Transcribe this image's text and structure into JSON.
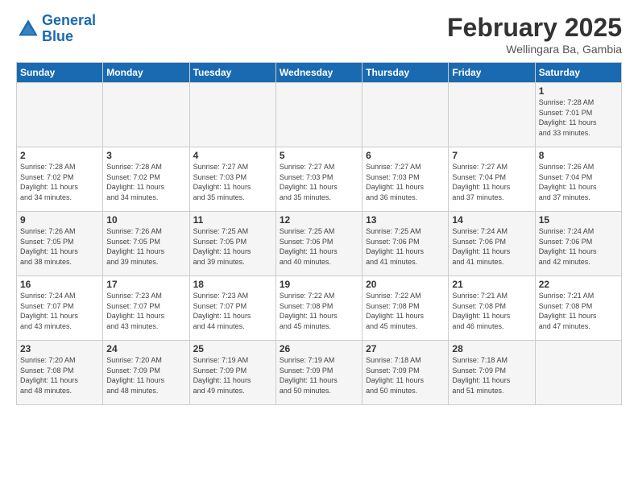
{
  "logo": {
    "line1": "General",
    "line2": "Blue"
  },
  "title": "February 2025",
  "location": "Wellingara Ba, Gambia",
  "weekdays": [
    "Sunday",
    "Monday",
    "Tuesday",
    "Wednesday",
    "Thursday",
    "Friday",
    "Saturday"
  ],
  "weeks": [
    [
      {
        "day": "",
        "info": ""
      },
      {
        "day": "",
        "info": ""
      },
      {
        "day": "",
        "info": ""
      },
      {
        "day": "",
        "info": ""
      },
      {
        "day": "",
        "info": ""
      },
      {
        "day": "",
        "info": ""
      },
      {
        "day": "1",
        "info": "Sunrise: 7:28 AM\nSunset: 7:01 PM\nDaylight: 11 hours\nand 33 minutes."
      }
    ],
    [
      {
        "day": "2",
        "info": "Sunrise: 7:28 AM\nSunset: 7:02 PM\nDaylight: 11 hours\nand 34 minutes."
      },
      {
        "day": "3",
        "info": "Sunrise: 7:28 AM\nSunset: 7:02 PM\nDaylight: 11 hours\nand 34 minutes."
      },
      {
        "day": "4",
        "info": "Sunrise: 7:27 AM\nSunset: 7:03 PM\nDaylight: 11 hours\nand 35 minutes."
      },
      {
        "day": "5",
        "info": "Sunrise: 7:27 AM\nSunset: 7:03 PM\nDaylight: 11 hours\nand 35 minutes."
      },
      {
        "day": "6",
        "info": "Sunrise: 7:27 AM\nSunset: 7:03 PM\nDaylight: 11 hours\nand 36 minutes."
      },
      {
        "day": "7",
        "info": "Sunrise: 7:27 AM\nSunset: 7:04 PM\nDaylight: 11 hours\nand 37 minutes."
      },
      {
        "day": "8",
        "info": "Sunrise: 7:26 AM\nSunset: 7:04 PM\nDaylight: 11 hours\nand 37 minutes."
      }
    ],
    [
      {
        "day": "9",
        "info": "Sunrise: 7:26 AM\nSunset: 7:05 PM\nDaylight: 11 hours\nand 38 minutes."
      },
      {
        "day": "10",
        "info": "Sunrise: 7:26 AM\nSunset: 7:05 PM\nDaylight: 11 hours\nand 39 minutes."
      },
      {
        "day": "11",
        "info": "Sunrise: 7:25 AM\nSunset: 7:05 PM\nDaylight: 11 hours\nand 39 minutes."
      },
      {
        "day": "12",
        "info": "Sunrise: 7:25 AM\nSunset: 7:06 PM\nDaylight: 11 hours\nand 40 minutes."
      },
      {
        "day": "13",
        "info": "Sunrise: 7:25 AM\nSunset: 7:06 PM\nDaylight: 11 hours\nand 41 minutes."
      },
      {
        "day": "14",
        "info": "Sunrise: 7:24 AM\nSunset: 7:06 PM\nDaylight: 11 hours\nand 41 minutes."
      },
      {
        "day": "15",
        "info": "Sunrise: 7:24 AM\nSunset: 7:06 PM\nDaylight: 11 hours\nand 42 minutes."
      }
    ],
    [
      {
        "day": "16",
        "info": "Sunrise: 7:24 AM\nSunset: 7:07 PM\nDaylight: 11 hours\nand 43 minutes."
      },
      {
        "day": "17",
        "info": "Sunrise: 7:23 AM\nSunset: 7:07 PM\nDaylight: 11 hours\nand 43 minutes."
      },
      {
        "day": "18",
        "info": "Sunrise: 7:23 AM\nSunset: 7:07 PM\nDaylight: 11 hours\nand 44 minutes."
      },
      {
        "day": "19",
        "info": "Sunrise: 7:22 AM\nSunset: 7:08 PM\nDaylight: 11 hours\nand 45 minutes."
      },
      {
        "day": "20",
        "info": "Sunrise: 7:22 AM\nSunset: 7:08 PM\nDaylight: 11 hours\nand 45 minutes."
      },
      {
        "day": "21",
        "info": "Sunrise: 7:21 AM\nSunset: 7:08 PM\nDaylight: 11 hours\nand 46 minutes."
      },
      {
        "day": "22",
        "info": "Sunrise: 7:21 AM\nSunset: 7:08 PM\nDaylight: 11 hours\nand 47 minutes."
      }
    ],
    [
      {
        "day": "23",
        "info": "Sunrise: 7:20 AM\nSunset: 7:08 PM\nDaylight: 11 hours\nand 48 minutes."
      },
      {
        "day": "24",
        "info": "Sunrise: 7:20 AM\nSunset: 7:09 PM\nDaylight: 11 hours\nand 48 minutes."
      },
      {
        "day": "25",
        "info": "Sunrise: 7:19 AM\nSunset: 7:09 PM\nDaylight: 11 hours\nand 49 minutes."
      },
      {
        "day": "26",
        "info": "Sunrise: 7:19 AM\nSunset: 7:09 PM\nDaylight: 11 hours\nand 50 minutes."
      },
      {
        "day": "27",
        "info": "Sunrise: 7:18 AM\nSunset: 7:09 PM\nDaylight: 11 hours\nand 50 minutes."
      },
      {
        "day": "28",
        "info": "Sunrise: 7:18 AM\nSunset: 7:09 PM\nDaylight: 11 hours\nand 51 minutes."
      },
      {
        "day": "",
        "info": ""
      }
    ]
  ]
}
